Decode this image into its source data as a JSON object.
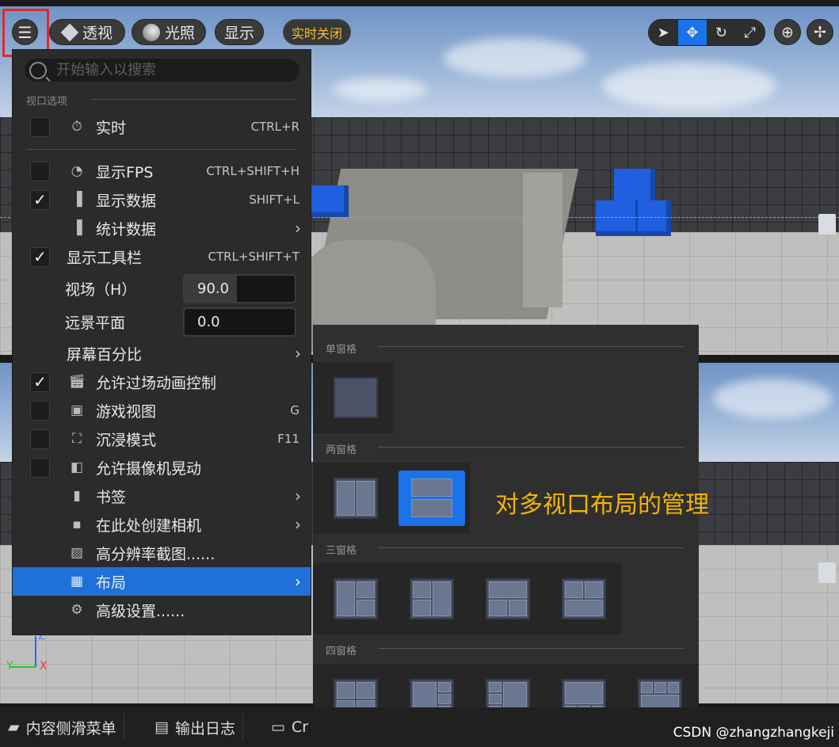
{
  "toolbar": {
    "perspective": "透视",
    "lighting": "光照",
    "show": "显示",
    "realtime_off": "实时关闭"
  },
  "menu": {
    "search_placeholder": "开始输入以搜索",
    "section_header": "视口选项",
    "items": [
      {
        "label": "实时",
        "shortcut": "CTRL+R",
        "checked": false,
        "icon": "stopwatch-icon"
      },
      {
        "label": "显示FPS",
        "shortcut": "CTRL+SHIFT+H",
        "checked": false,
        "icon": "gauge-icon"
      },
      {
        "label": "显示数据",
        "shortcut": "SHIFT+L",
        "checked": true,
        "icon": "bar-chart-icon"
      },
      {
        "label": "统计数据",
        "submenu": true,
        "icon": "bar-chart-icon"
      },
      {
        "label": "显示工具栏",
        "shortcut": "CTRL+SHIFT+T",
        "checked": true
      },
      {
        "label": "视场（H）",
        "value": "90.0"
      },
      {
        "label": "远景平面",
        "value": "0.0"
      },
      {
        "label": "屏幕百分比",
        "submenu": true
      },
      {
        "label": "允许过场动画控制",
        "checked": true,
        "icon": "clapperboard-icon"
      },
      {
        "label": "游戏视图",
        "shortcut": "G",
        "checked": false,
        "icon": "gamepad-icon"
      },
      {
        "label": "沉浸模式",
        "shortcut": "F11",
        "checked": false,
        "icon": "fullscreen-icon"
      },
      {
        "label": "允许摄像机晃动",
        "checked": false,
        "icon": "camera-shake-icon"
      },
      {
        "label": "书签",
        "submenu": true,
        "icon": "bookmark-icon"
      },
      {
        "label": "在此处创建相机",
        "submenu": true,
        "icon": "camera-add-icon"
      },
      {
        "label": "高分辨率截图......",
        "icon": "image-icon"
      },
      {
        "label": "布局",
        "submenu": true,
        "selected": true,
        "icon": "layout-icon"
      },
      {
        "label": "高级设置......",
        "icon": "gear-icon"
      }
    ]
  },
  "layout_submenu": {
    "one_pane": "单窗格",
    "two_pane": "两窗格",
    "three_pane": "三窗格",
    "four_pane": "四窗格"
  },
  "annotation": "对多视口布局的管理",
  "bottom_bar": {
    "content_drawer": "内容侧滑菜单",
    "output_log": "输出日志",
    "cmd": "Cr"
  },
  "watermark": "CSDN @zhangzhangkeji",
  "colors": {
    "accent": "#1a73e8",
    "highlight_box": "#e02a2a",
    "annotation": "#f4b400",
    "realtime_off": "#f1c232"
  }
}
